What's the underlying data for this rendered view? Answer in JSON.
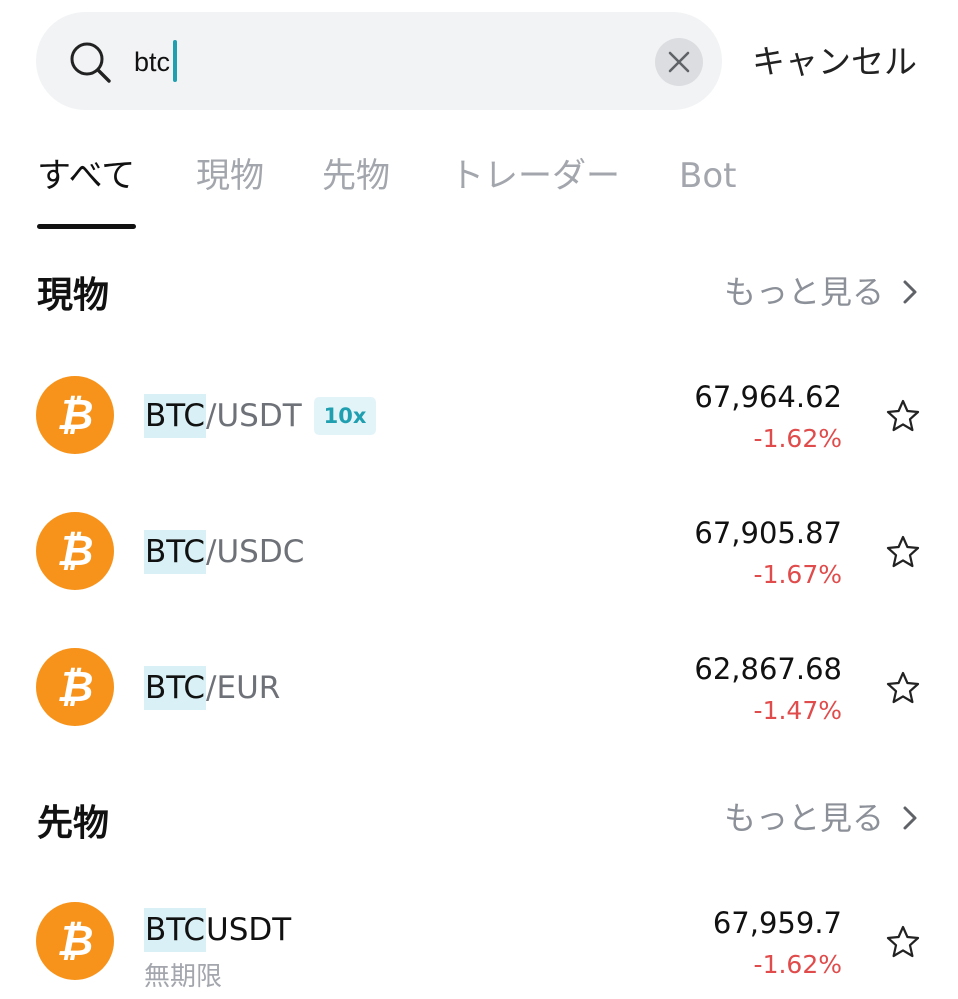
{
  "search": {
    "value": "btc",
    "cancel_label": "キャンセル"
  },
  "tabs": [
    {
      "label": "すべて",
      "active": true
    },
    {
      "label": "現物",
      "active": false
    },
    {
      "label": "先物",
      "active": false
    },
    {
      "label": "トレーダー",
      "active": false
    },
    {
      "label": "Bot",
      "active": false
    }
  ],
  "sections": {
    "spot": {
      "title": "現物",
      "more_label": "もっと見る",
      "items": [
        {
          "base": "BTC",
          "quote": "/USDT",
          "badge": "10x",
          "price": "67,964.62",
          "change": "-1.62%"
        },
        {
          "base": "BTC",
          "quote": "/USDC",
          "price": "67,905.87",
          "change": "-1.67%"
        },
        {
          "base": "BTC",
          "quote": "/EUR",
          "price": "62,867.68",
          "change": "-1.47%"
        }
      ]
    },
    "futures": {
      "title": "先物",
      "more_label": "もっと見る",
      "items": [
        {
          "base": "BTC",
          "quote": "USDT",
          "subtitle": "無期限",
          "price": "67,959.7",
          "change": "-1.62%"
        }
      ]
    }
  },
  "icons": {
    "search": "search-icon",
    "clear": "clear-icon",
    "chevron": "chevron-right-icon",
    "star": "star-outline-icon",
    "coin": "bitcoin-icon"
  },
  "colors": {
    "accent": "#1f9fb0",
    "highlight": "#d9f1f6",
    "negative": "#e04b4b",
    "bitcoin": "#f7931a",
    "search_bg": "#f2f3f5"
  }
}
